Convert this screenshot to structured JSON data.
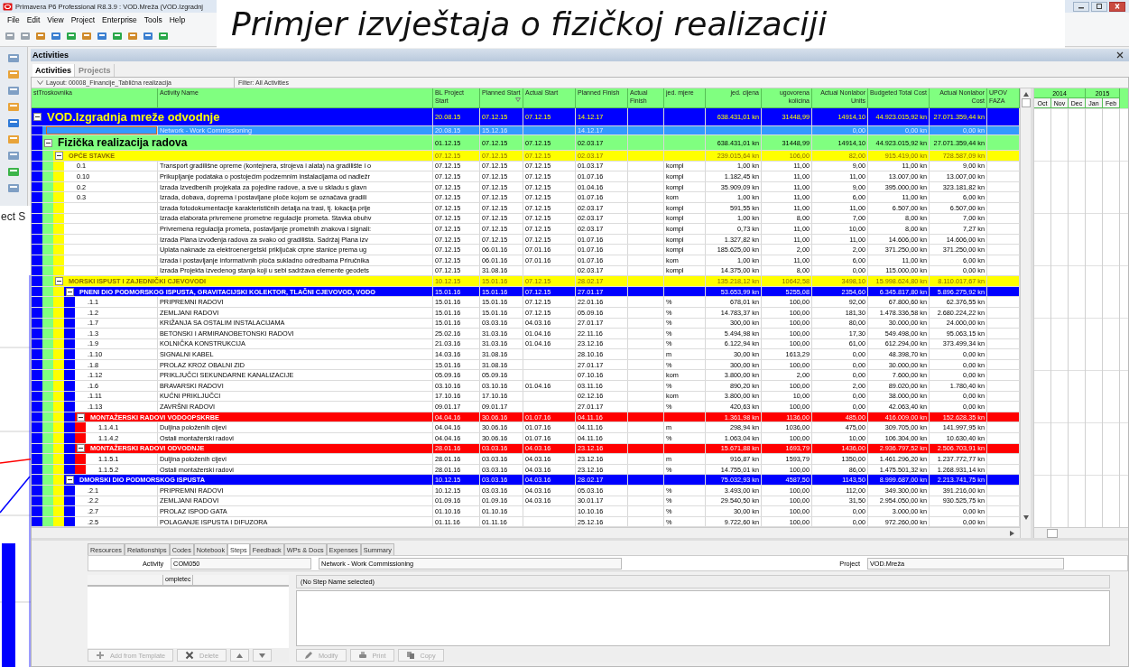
{
  "window": {
    "title": "Primavera P6 Professional R8.3.9 : VOD.Mreža (VOD.Izgradnj"
  },
  "menu": [
    "File",
    "Edit",
    "View",
    "Project",
    "Enterprise",
    "Tools",
    "Help"
  ],
  "slide_title": "Primjer izvještaja o fizičkoj realizaciji",
  "overlay_text": "ect S",
  "panel": {
    "title": "Activities"
  },
  "tabs": [
    {
      "label": "Activities",
      "selected": true
    },
    {
      "label": "Projects",
      "selected": false
    }
  ],
  "layout_label": "Layout: 00008_Financije_Tablična realizacija",
  "filter_label": "Filter: All Activities",
  "table": {
    "tree_columns": [
      {
        "label": "stTroskovnika",
        "sorted": false
      },
      {
        "label": "Activity Name",
        "sorted": false
      }
    ],
    "columns": [
      {
        "label": "BL Project Start",
        "kind": "text",
        "sorted": false
      },
      {
        "label": "Planned Start",
        "kind": "text",
        "sorted": true
      },
      {
        "label": "Actual Start",
        "kind": "text",
        "sorted": false
      },
      {
        "label": "Planned Finish",
        "kind": "text",
        "sorted": false
      },
      {
        "label": "Actual Finish",
        "kind": "text",
        "sorted": false
      },
      {
        "label": "jed. mjere",
        "kind": "text",
        "sorted": false
      },
      {
        "label": "jed. cijena",
        "kind": "number",
        "sorted": false
      },
      {
        "label": "ugovorena kolicina",
        "kind": "number",
        "sorted": false
      },
      {
        "label": "Actual Nonlabor Units",
        "kind": "number",
        "sorted": false
      },
      {
        "label": "Budgeted Total Cost",
        "kind": "number",
        "sorted": false
      },
      {
        "label": "Actual Nonlabor Cost",
        "kind": "number",
        "sorted": false
      },
      {
        "label": "UPOV FAZA",
        "kind": "text",
        "sorted": false
      }
    ],
    "rows": [
      {
        "kind": "project",
        "name": "VOD.Izgradnja mreže odvodnje",
        "color": "#0000ff",
        "expanded": true,
        "selected": false,
        "cells": [
          "20.08.15",
          "07.12.15",
          "07.12.15",
          "14.12.17",
          null,
          null,
          "638.431,01 kn",
          "31448,99",
          "14914,10",
          "44.923.015,92 kn",
          "27.071.359,44 kn"
        ],
        "children": [
          {
            "kind": "activity",
            "name": "Network - Work Commissioning",
            "selected": true,
            "cells": [
              "20.08.15",
              "15.12.16",
              null,
              "14.12.17",
              null,
              null,
              null,
              null,
              "0,00",
              "0,00 kn",
              "0,00 kn"
            ]
          },
          {
            "kind": "wbs",
            "name": "Fizička realizacija radova",
            "color": "#80ff80",
            "expanded": true,
            "selected": false,
            "cells": [
              "01.12.15",
              "07.12.15",
              "07.12.15",
              "02.03.17",
              null,
              null,
              "638.431,01 kn",
              "31448,99",
              "14914,10",
              "44.923.015,92 kn",
              "27.071.359,44 kn"
            ],
            "children": [
              {
                "kind": "wbs",
                "name": "OPĆE STAVKE",
                "color": "#ffff00",
                "expanded": true,
                "selected": false,
                "cells": [
                  "07.12.15",
                  "07.12.15",
                  "07.12.15",
                  "02.03.17",
                  null,
                  null,
                  "239.015,64 kn",
                  "106,00",
                  "82,00",
                  "915.419,00 kn",
                  "728.587,09 kn"
                ],
                "children": [
                  {
                    "kind": "activity",
                    "id": "0.1",
                    "name": "Transport gradilišne opreme (kontejnera, strojeva i alata) na gradilište i o",
                    "selected": false,
                    "cells": [
                      "07.12.15",
                      "07.12.15",
                      "07.12.15",
                      "01.03.17",
                      null,
                      "kompl",
                      "1,00 kn",
                      "11,00",
                      "9,00",
                      "11,00 kn",
                      "9,00 kn"
                    ]
                  },
                  {
                    "kind": "activity",
                    "id": "0.10",
                    "name": "Prikupljanje podataka o postojećim podzemnim instalacijama od nadležr",
                    "selected": false,
                    "cells": [
                      "07.12.15",
                      "07.12.15",
                      "07.12.15",
                      "01.07.16",
                      null,
                      "kompl",
                      "1.182,45 kn",
                      "11,00",
                      "11,00",
                      "13.007,00 kn",
                      "13.007,00 kn"
                    ]
                  },
                  {
                    "kind": "activity",
                    "id": "0.2",
                    "name": "Izrada Izvedbenih projekata za pojedine radove, a sve u skladu s glavn",
                    "selected": false,
                    "cells": [
                      "07.12.15",
                      "07.12.15",
                      "07.12.15",
                      "01.04.16",
                      null,
                      "kompl",
                      "35.909,09 kn",
                      "11,00",
                      "9,00",
                      "395.000,00 kn",
                      "323.181,82 kn"
                    ]
                  },
                  {
                    "kind": "activity",
                    "id": "0.3",
                    "name": "Izrada, dobava, doprema i postavljane ploče kojom se označava gradili",
                    "selected": false,
                    "cells": [
                      "07.12.15",
                      "07.12.15",
                      "07.12.15",
                      "01.07.16",
                      null,
                      "kom",
                      "1,00 kn",
                      "11,00",
                      "6,00",
                      "11,00 kn",
                      "6,00 kn"
                    ]
                  },
                  {
                    "kind": "activity",
                    "name": "Izrada fotodokumentacije karakterističnih detalja na trasi, tj. lokacija prije",
                    "selected": false,
                    "cells": [
                      "07.12.15",
                      "07.12.15",
                      "07.12.15",
                      "02.03.17",
                      null,
                      "kompl",
                      "591,55 kn",
                      "11,00",
                      "11,00",
                      "6.507,00 kn",
                      "6.507,00 kn"
                    ]
                  },
                  {
                    "kind": "activity",
                    "name": "Izrada elaborata privremene prometne regulacije prometa. Stavka obuhv",
                    "selected": false,
                    "cells": [
                      "07.12.15",
                      "07.12.15",
                      "07.12.15",
                      "02.03.17",
                      null,
                      "kompl",
                      "1,00 kn",
                      "8,00",
                      "7,00",
                      "8,00 kn",
                      "7,00 kn"
                    ]
                  },
                  {
                    "kind": "activity",
                    "name": "Privremena regulacija prometa, postavljanje prometnih znakova i signali:",
                    "selected": false,
                    "cells": [
                      "07.12.15",
                      "07.12.15",
                      "07.12.15",
                      "02.03.17",
                      null,
                      "kompl",
                      "0,73 kn",
                      "11,00",
                      "10,00",
                      "8,00 kn",
                      "7,27 kn"
                    ]
                  },
                  {
                    "kind": "activity",
                    "name": "Izrada Plana izvođenja radova za svako od gradilišta. Sadržaj Plana izv",
                    "selected": false,
                    "cells": [
                      "07.12.15",
                      "07.12.15",
                      "07.12.15",
                      "01.07.16",
                      null,
                      "kompl",
                      "1.327,82 kn",
                      "11,00",
                      "11,00",
                      "14.606,00 kn",
                      "14.606,00 kn"
                    ]
                  },
                  {
                    "kind": "activity",
                    "name": "Uplata naknade za elektroenergetski priključak crpne stanice prema ug",
                    "selected": false,
                    "cells": [
                      "07.12.15",
                      "06.01.16",
                      "07.01.16",
                      "01.07.16",
                      null,
                      "kompl",
                      "185.625,00 kn",
                      "2,00",
                      "2,00",
                      "371.250,00 kn",
                      "371.250,00 kn"
                    ]
                  },
                  {
                    "kind": "activity",
                    "name": "Izrada i postavljanje informativnih ploča sukladno odredbama Priručnika",
                    "selected": false,
                    "cells": [
                      "07.12.15",
                      "06.01.16",
                      "07.01.16",
                      "01.07.16",
                      null,
                      "kom",
                      "1,00 kn",
                      "11,00",
                      "6,00",
                      "11,00 kn",
                      "6,00 kn"
                    ]
                  },
                  {
                    "kind": "activity",
                    "name": "Izrada Projekta izvedenog stanja koji u sebi sadržava elemente geodets",
                    "selected": false,
                    "cells": [
                      "07.12.15",
                      "31.08.16",
                      null,
                      "02.03.17",
                      null,
                      "kompl",
                      "14.375,00 kn",
                      "8,00",
                      "0,00",
                      "115.000,00 kn",
                      "0,00 kn"
                    ]
                  }
                ]
              },
              {
                "kind": "wbs",
                "name": "MORSKI ISPUST I ZAJEDNIČKI CJEVOVODI",
                "color": "#ffff00",
                "expanded": true,
                "selected": false,
                "cells": [
                  "10.12.15",
                  "15.01.16",
                  "07.12.15",
                  "28.02.17",
                  null,
                  null,
                  "135.218,12 kn",
                  "10642,58",
                  "3498,10",
                  "15.998.624,80 kn",
                  "8.110.017,67 kn"
                ],
                "children": [
                  {
                    "kind": "wbs",
                    "name": "PNENI DIO PODMORSKOG ISPUSTA, GRAVITACIJSKI KOLEKTOR, TLAČNI CJEVOVOD, VODO",
                    "color": "#0000ff",
                    "expanded": true,
                    "selected": false,
                    "cells": [
                      "15.01.16",
                      "15.01.16",
                      "07.12.15",
                      "27.01.17",
                      null,
                      null,
                      "53.653,99 kn",
                      "5255,08",
                      "2354,60",
                      "6.345.817,80 kn",
                      "5.896.275,92 kn"
                    ],
                    "children": [
                      {
                        "kind": "activity",
                        "id": ".1.1",
                        "name": "PRIPREMNI RADOVI",
                        "selected": false,
                        "cells": [
                          "15.01.16",
                          "15.01.16",
                          "07.12.15",
                          "22.01.16",
                          null,
                          "%",
                          "678,01 kn",
                          "100,00",
                          "92,00",
                          "67.800,60 kn",
                          "62.376,55 kn"
                        ]
                      },
                      {
                        "kind": "activity",
                        "id": ".1.2",
                        "name": "ZEMLJANI RADOVI",
                        "selected": false,
                        "cells": [
                          "15.01.16",
                          "15.01.16",
                          "07.12.15",
                          "05.09.16",
                          null,
                          "%",
                          "14.783,37 kn",
                          "100,00",
                          "181,30",
                          "1.478.336,58 kn",
                          "2.680.224,22 kn"
                        ]
                      },
                      {
                        "kind": "activity",
                        "id": ".1.7",
                        "name": "KRIŽANJA SA OSTALIM INSTALACIJAMA",
                        "selected": false,
                        "cells": [
                          "15.01.16",
                          "03.03.16",
                          "04.03.16",
                          "27.01.17",
                          null,
                          "%",
                          "300,00 kn",
                          "100,00",
                          "80,00",
                          "30.000,00 kn",
                          "24.000,00 kn"
                        ]
                      },
                      {
                        "kind": "activity",
                        "id": ".1.3",
                        "name": "BETONSKI I ARMIRANOBETONSKI RADOVI",
                        "selected": false,
                        "cells": [
                          "25.02.16",
                          "31.03.16",
                          "01.04.16",
                          "22.11.16",
                          null,
                          "%",
                          "5.494,98 kn",
                          "100,00",
                          "17,30",
                          "549.498,00 kn",
                          "95.063,15 kn"
                        ]
                      },
                      {
                        "kind": "activity",
                        "id": ".1.9",
                        "name": "KOLNIČKA KONSTRUKCIJA",
                        "selected": false,
                        "cells": [
                          "21.03.16",
                          "31.03.16",
                          "01.04.16",
                          "23.12.16",
                          null,
                          "%",
                          "6.122,94 kn",
                          "100,00",
                          "61,00",
                          "612.294,00 kn",
                          "373.499,34 kn"
                        ]
                      },
                      {
                        "kind": "activity",
                        "id": ".1.10",
                        "name": "SIGNALNI KABEL",
                        "selected": false,
                        "cells": [
                          "14.03.16",
                          "31.08.16",
                          null,
                          "28.10.16",
                          null,
                          "m",
                          "30,00 kn",
                          "1613,29",
                          "0,00",
                          "48.398,70 kn",
                          "0,00 kn"
                        ]
                      },
                      {
                        "kind": "activity",
                        "id": ".1.8",
                        "name": "PROLAZ KROZ OBALNI ZID",
                        "selected": false,
                        "cells": [
                          "15.01.16",
                          "31.08.16",
                          null,
                          "27.01.17",
                          null,
                          "%",
                          "300,00 kn",
                          "100,00",
                          "0,00",
                          "30.000,00 kn",
                          "0,00 kn"
                        ]
                      },
                      {
                        "kind": "activity",
                        "id": ".1.12",
                        "name": "PRIKLJUČCI SEKUNDARNE KANALIZACIJE",
                        "selected": false,
                        "cells": [
                          "05.09.16",
                          "05.09.16",
                          null,
                          "07.10.16",
                          null,
                          "kom",
                          "3.800,00 kn",
                          "2,00",
                          "0,00",
                          "7.600,00 kn",
                          "0,00 kn"
                        ]
                      },
                      {
                        "kind": "activity",
                        "id": ".1.6",
                        "name": "BRAVARSKI RADOVI",
                        "selected": false,
                        "cells": [
                          "03.10.16",
                          "03.10.16",
                          "01.04.16",
                          "03.11.16",
                          null,
                          "%",
                          "890,20 kn",
                          "100,00",
                          "2,00",
                          "89.020,00 kn",
                          "1.780,40 kn"
                        ]
                      },
                      {
                        "kind": "activity",
                        "id": ".1.11",
                        "name": "KUĆNI PRIKLJUČCI",
                        "selected": false,
                        "cells": [
                          "17.10.16",
                          "17.10.16",
                          null,
                          "02.12.16",
                          null,
                          "kom",
                          "3.800,00 kn",
                          "10,00",
                          "0,00",
                          "38.000,00 kn",
                          "0,00 kn"
                        ]
                      },
                      {
                        "kind": "activity",
                        "id": ".1.13",
                        "name": "ZAVRŠNI RADOVI",
                        "selected": false,
                        "cells": [
                          "09.01.17",
                          "09.01.17",
                          null,
                          "27.01.17",
                          null,
                          "%",
                          "420,63 kn",
                          "100,00",
                          "0,00",
                          "42.063,40 kn",
                          "0,00 kn"
                        ]
                      },
                      {
                        "kind": "wbs",
                        "name": "MONTAŽERSKI RADOVI VODOOPSKRBE",
                        "color": "#ff0000",
                        "expanded": true,
                        "selected": false,
                        "cells": [
                          "04.04.16",
                          "30.06.16",
                          "01.07.16",
                          "04.11.16",
                          null,
                          null,
                          "1.361,98 kn",
                          "1136,00",
                          "485,00",
                          "416.009,00 kn",
                          "152.628,35 kn"
                        ],
                        "children": [
                          {
                            "kind": "activity",
                            "id": "1.1.4.1",
                            "name": "Duljina položenih cijevi",
                            "selected": false,
                            "cells": [
                              "04.04.16",
                              "30.06.16",
                              "01.07.16",
                              "04.11.16",
                              null,
                              "m",
                              "298,94 kn",
                              "1036,00",
                              "475,00",
                              "309.705,00 kn",
                              "141.997,95 kn"
                            ]
                          },
                          {
                            "kind": "activity",
                            "id": "1.1.4.2",
                            "name": "Ostali montažerski radovi",
                            "selected": false,
                            "cells": [
                              "04.04.16",
                              "30.06.16",
                              "01.07.16",
                              "04.11.16",
                              null,
                              "%",
                              "1.063,04 kn",
                              "100,00",
                              "10,00",
                              "106.304,00 kn",
                              "10.630,40 kn"
                            ]
                          }
                        ]
                      },
                      {
                        "kind": "wbs",
                        "name": "MONTAŽERSKI RADOVI ODVODNJE",
                        "color": "#ff0000",
                        "expanded": true,
                        "selected": false,
                        "cells": [
                          "28.01.16",
                          "03.03.16",
                          "04.03.16",
                          "23.12.16",
                          null,
                          null,
                          "15.671,88 kn",
                          "1693,79",
                          "1436,00",
                          "2.936.797,52 kn",
                          "2.506.703,91 kn"
                        ],
                        "children": [
                          {
                            "kind": "activity",
                            "id": "1.1.5.1",
                            "name": "Duljina položenih cijevi",
                            "selected": false,
                            "cells": [
                              "28.01.16",
                              "03.03.16",
                              "04.03.16",
                              "23.12.16",
                              null,
                              "m",
                              "916,87 kn",
                              "1593,79",
                              "1350,00",
                              "1.461.296,20 kn",
                              "1.237.772,77 kn"
                            ]
                          },
                          {
                            "kind": "activity",
                            "id": "1.1.5.2",
                            "name": "Ostali montažerski radovi",
                            "selected": false,
                            "cells": [
                              "28.01.16",
                              "03.03.16",
                              "04.03.16",
                              "23.12.16",
                              null,
                              "%",
                              "14.755,01 kn",
                              "100,00",
                              "86,00",
                              "1.475.501,32 kn",
                              "1.268.931,14 kn"
                            ]
                          }
                        ]
                      }
                    ]
                  },
                  {
                    "kind": "wbs",
                    "name": "DMORSKI DIO PODMORSKOG ISPUSTA",
                    "color": "#0000ff",
                    "expanded": true,
                    "selected": false,
                    "cells": [
                      "10.12.15",
                      "03.03.16",
                      "04.03.16",
                      "28.02.17",
                      null,
                      null,
                      "75.032,93 kn",
                      "4587,50",
                      "1143,50",
                      "8.999.687,00 kn",
                      "2.213.741,75 kn"
                    ],
                    "children": [
                      {
                        "kind": "activity",
                        "id": ".2.1",
                        "name": "PRIPREMNI RADOVI",
                        "selected": false,
                        "cells": [
                          "10.12.15",
                          "03.03.16",
                          "04.03.16",
                          "05.03.16",
                          null,
                          "%",
                          "3.493,00 kn",
                          "100,00",
                          "112,00",
                          "349.300,00 kn",
                          "391.216,00 kn"
                        ]
                      },
                      {
                        "kind": "activity",
                        "id": ".2.2",
                        "name": "ZEMLJANI RADOVI",
                        "selected": false,
                        "cells": [
                          "01.09.16",
                          "01.09.16",
                          "04.03.16",
                          "30.01.17",
                          null,
                          "%",
                          "29.540,50 kn",
                          "100,00",
                          "31,50",
                          "2.954.050,00 kn",
                          "930.525,75 kn"
                        ]
                      },
                      {
                        "kind": "activity",
                        "id": ".2.7",
                        "name": "PROLAZ ISPOD GATA",
                        "selected": false,
                        "cells": [
                          "01.10.16",
                          "01.10.16",
                          null,
                          "10.10.16",
                          null,
                          "%",
                          "30,00 kn",
                          "100,00",
                          "0,00",
                          "3.000,00 kn",
                          "0,00 kn"
                        ]
                      },
                      {
                        "kind": "activity",
                        "id": ".2.5",
                        "name": "POLAGANJE ISPUSTA I DIFUZORA",
                        "selected": false,
                        "cells": [
                          "01.11.16",
                          "01.11.16",
                          null,
                          "25.12.16",
                          null,
                          "%",
                          "9.722,60 kn",
                          "100,00",
                          "0,00",
                          "972.260,00 kn",
                          "0,00 kn"
                        ]
                      }
                    ]
                  }
                ]
              }
            ]
          }
        ]
      }
    ]
  },
  "gantt": {
    "years": [
      {
        "label": "2014",
        "months": [
          "Oct",
          "Nov",
          "Dec"
        ]
      },
      {
        "label": "2015",
        "months": [
          "Jan",
          "Feb"
        ]
      }
    ]
  },
  "details": {
    "tabs": [
      {
        "label": "Resources",
        "selected": false
      },
      {
        "label": "Relationships",
        "selected": false
      },
      {
        "label": "Codes",
        "selected": false
      },
      {
        "label": "Notebook",
        "selected": false
      },
      {
        "label": "Steps",
        "selected": true
      },
      {
        "label": "Feedback",
        "selected": false
      },
      {
        "label": "WPs & Docs",
        "selected": false
      },
      {
        "label": "Expenses",
        "selected": false
      },
      {
        "label": "Summary",
        "selected": false
      }
    ],
    "activity_label": "Activity",
    "activity_id": "COM050",
    "activity_name": "Network - Work Commissioning",
    "project_label": "Project",
    "project_id": "VOD.Mreža",
    "steps_column": "ompletec",
    "step_header": "(No Step Name selected)",
    "left_buttons": [
      {
        "label": "Add from Template",
        "disabled": true
      },
      {
        "label": "Delete",
        "disabled": true
      }
    ],
    "right_buttons": [
      {
        "label": "Modify",
        "disabled": true
      },
      {
        "label": "Print",
        "disabled": true
      },
      {
        "label": "Copy",
        "disabled": true
      }
    ]
  }
}
